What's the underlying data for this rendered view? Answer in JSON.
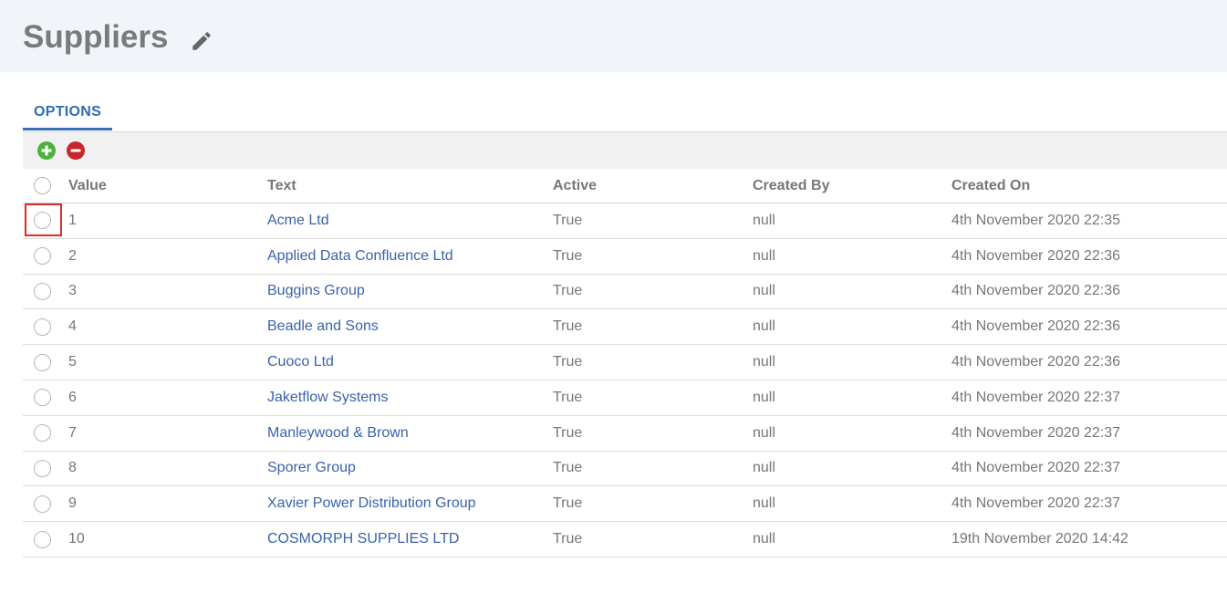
{
  "header": {
    "title": "Suppliers",
    "edit_icon": "pencil-icon"
  },
  "tabs": [
    {
      "label": "OPTIONS"
    }
  ],
  "toolbar": {
    "add_icon": "plus-circle-icon",
    "remove_icon": "minus-circle-icon",
    "add_color": "#4bb33b",
    "remove_color": "#c8262b"
  },
  "table": {
    "columns": [
      "Value",
      "Text",
      "Active",
      "Created By",
      "Created On"
    ],
    "rows": [
      {
        "value": "1",
        "text": "Acme Ltd",
        "active": "True",
        "created_by": "null",
        "created_on": "4th November 2020 22:35"
      },
      {
        "value": "2",
        "text": "Applied Data Confluence Ltd",
        "active": "True",
        "created_by": "null",
        "created_on": "4th November 2020 22:36"
      },
      {
        "value": "3",
        "text": "Buggins Group",
        "active": "True",
        "created_by": "null",
        "created_on": "4th November 2020 22:36"
      },
      {
        "value": "4",
        "text": "Beadle and Sons",
        "active": "True",
        "created_by": "null",
        "created_on": "4th November 2020 22:36"
      },
      {
        "value": "5",
        "text": "Cuoco Ltd",
        "active": "True",
        "created_by": "null",
        "created_on": "4th November 2020 22:36"
      },
      {
        "value": "6",
        "text": "Jaketflow Systems",
        "active": "True",
        "created_by": "null",
        "created_on": "4th November 2020 22:37"
      },
      {
        "value": "7",
        "text": "Manleywood & Brown",
        "active": "True",
        "created_by": "null",
        "created_on": "4th November 2020 22:37"
      },
      {
        "value": "8",
        "text": "Sporer Group",
        "active": "True",
        "created_by": "null",
        "created_on": "4th November 2020 22:37"
      },
      {
        "value": "9",
        "text": "Xavier Power Distribution Group",
        "active": "True",
        "created_by": "null",
        "created_on": "4th November 2020 22:37"
      },
      {
        "value": "10",
        "text": "COSMORPH SUPPLIES LTD",
        "active": "True",
        "created_by": "null",
        "created_on": "19th November 2020 14:42"
      }
    ]
  },
  "colors": {
    "link": "#3a62ad",
    "tab_accent": "#3d6fb6",
    "highlight": "#e02b2b",
    "header_bg": "#f1f5fa"
  }
}
